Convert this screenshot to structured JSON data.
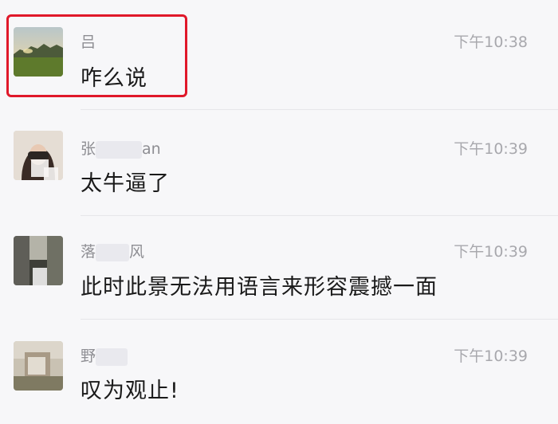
{
  "messages": [
    {
      "name": "吕",
      "time": "下午10:38",
      "text": "咋么说"
    },
    {
      "name_prefix": "张",
      "name_suffix": "an",
      "time": "下午10:39",
      "text": "太牛逼了"
    },
    {
      "name_prefix": "落",
      "name_suffix": "风",
      "time": "下午10:39",
      "text": "此时此景无法用语言来形容震撼一面"
    },
    {
      "name_prefix": "野",
      "name_suffix": "",
      "time": "下午10:39",
      "text": "叹为观止!"
    }
  ],
  "colors": {
    "highlight_border": "#e0182a",
    "name": "#8e8e93",
    "time": "#a8a8ad",
    "text": "#1a1a1a"
  },
  "icons": [
    "avatar-landscape",
    "avatar-person-blurred",
    "avatar-blurred",
    "avatar-blurred"
  ]
}
